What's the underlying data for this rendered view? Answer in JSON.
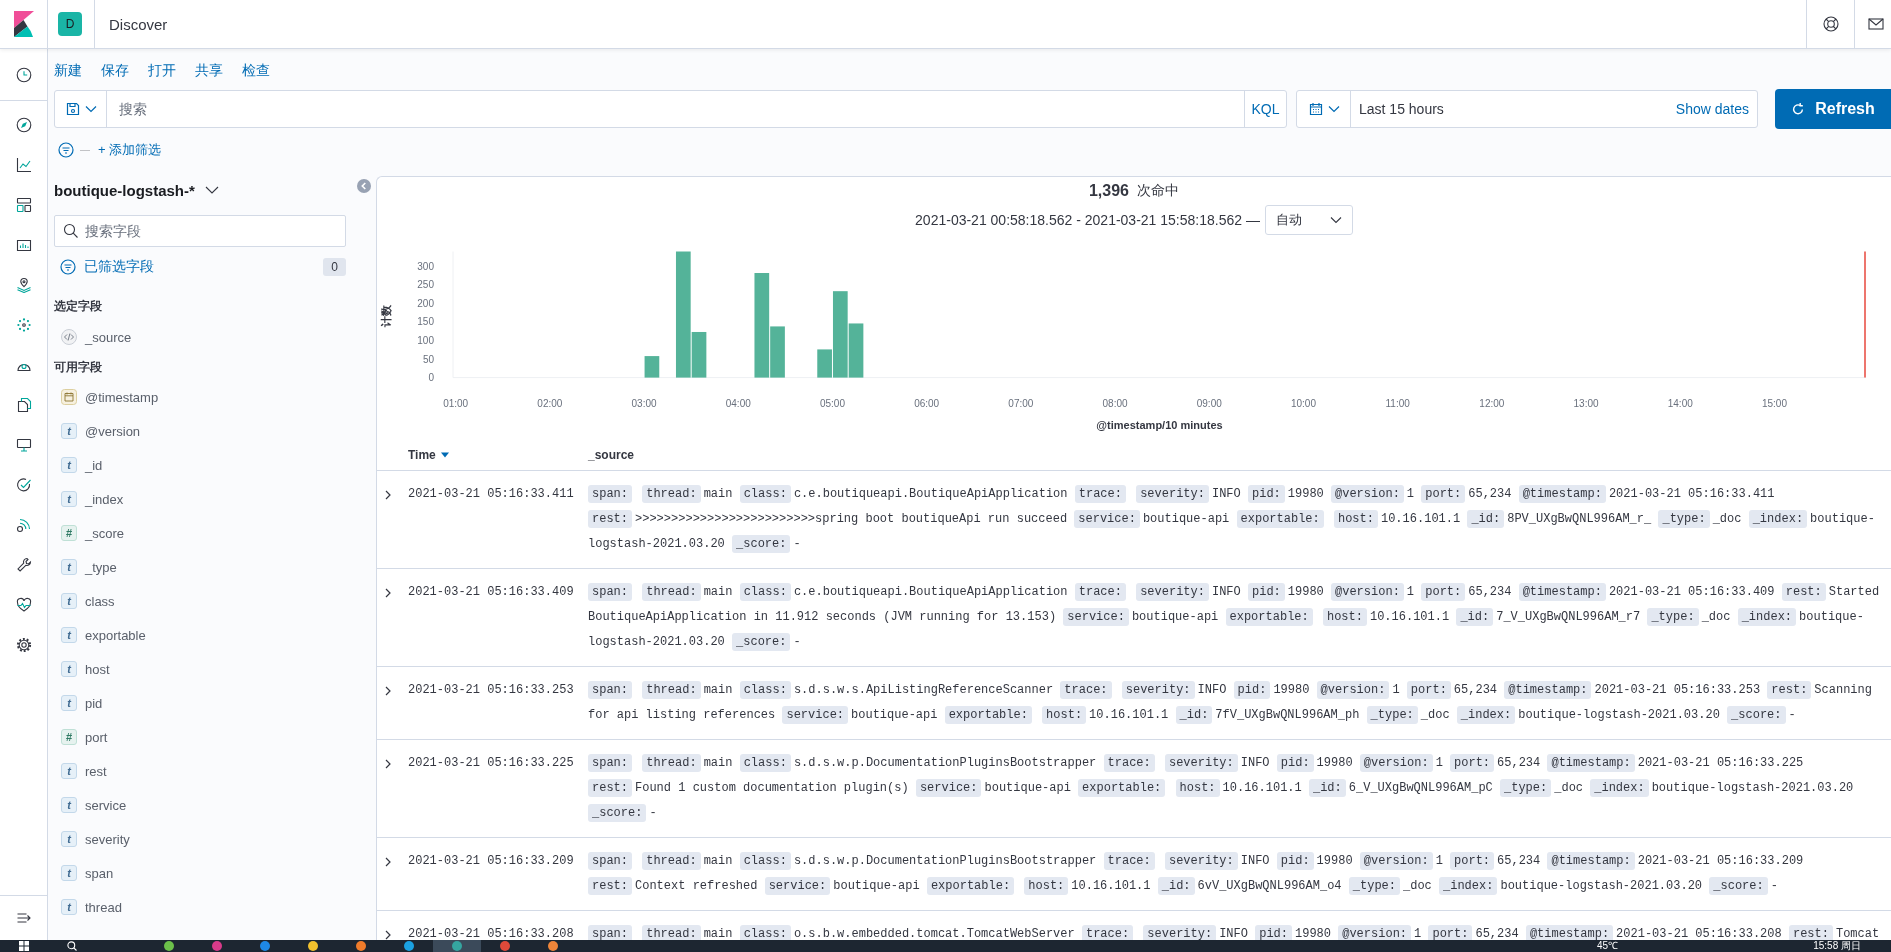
{
  "header": {
    "space": "D",
    "title": "Discover"
  },
  "top_menu": [
    "新建",
    "保存",
    "打开",
    "共享",
    "检查"
  ],
  "query_bar": {
    "placeholder": "搜索",
    "language": "KQL"
  },
  "date_picker": {
    "value": "Last 15 hours",
    "show_dates": "Show dates"
  },
  "refresh_button": "Refresh",
  "filter_bar": {
    "add_filter": "+ 添加筛选"
  },
  "sidebar": {
    "index_pattern": "boutique-logstash-*",
    "search_placeholder": "搜索字段",
    "filtered_fields": {
      "label": "已筛选字段",
      "count": "0"
    },
    "selected_heading": "选定字段",
    "selected_fields": [
      {
        "name": "_source",
        "kind": "source"
      }
    ],
    "available_heading": "可用字段",
    "available_fields": [
      {
        "name": "@timestamp",
        "kind": "date"
      },
      {
        "name": "@version",
        "kind": "string",
        "token": "t"
      },
      {
        "name": "_id",
        "kind": "string",
        "token": "t"
      },
      {
        "name": "_index",
        "kind": "string",
        "token": "t"
      },
      {
        "name": "_score",
        "kind": "number",
        "token": "#"
      },
      {
        "name": "_type",
        "kind": "string",
        "token": "t"
      },
      {
        "name": "class",
        "kind": "string",
        "token": "t"
      },
      {
        "name": "exportable",
        "kind": "string",
        "token": "t"
      },
      {
        "name": "host",
        "kind": "string",
        "token": "t"
      },
      {
        "name": "pid",
        "kind": "string",
        "token": "t"
      },
      {
        "name": "port",
        "kind": "number",
        "token": "#"
      },
      {
        "name": "rest",
        "kind": "string",
        "token": "t"
      },
      {
        "name": "service",
        "kind": "string",
        "token": "t"
      },
      {
        "name": "severity",
        "kind": "string",
        "token": "t"
      },
      {
        "name": "span",
        "kind": "string",
        "token": "t"
      },
      {
        "name": "thread",
        "kind": "string",
        "token": "t"
      }
    ]
  },
  "histogram": {
    "hits": "1,396",
    "hits_label": "次命中",
    "range": "2021-03-21 00:58:18.562 - 2021-03-21 15:58:18.562 —",
    "interval": "自动",
    "chart_data": {
      "type": "bar",
      "xlabel": "@timestamp/10 minutes",
      "ylabel": "计数",
      "x": [
        185,
        205,
        215,
        255,
        265,
        295,
        305,
        315
      ],
      "values": [
        58,
        340,
        123,
        282,
        138,
        76,
        233,
        146
      ],
      "xlim": [
        58.3,
        958.3
      ],
      "ylim": [
        0,
        340
      ],
      "xticks": [
        {
          "value": 60,
          "label": "01:00"
        },
        {
          "value": 120,
          "label": "02:00"
        },
        {
          "value": 180,
          "label": "03:00"
        },
        {
          "value": 240,
          "label": "04:00"
        },
        {
          "value": 300,
          "label": "05:00"
        },
        {
          "value": 360,
          "label": "06:00"
        },
        {
          "value": 420,
          "label": "07:00"
        },
        {
          "value": 480,
          "label": "08:00"
        },
        {
          "value": 540,
          "label": "09:00"
        },
        {
          "value": 600,
          "label": "10:00"
        },
        {
          "value": 660,
          "label": "11:00"
        },
        {
          "value": 720,
          "label": "12:00"
        },
        {
          "value": 780,
          "label": "13:00"
        },
        {
          "value": 840,
          "label": "14:00"
        },
        {
          "value": 900,
          "label": "15:00"
        }
      ],
      "yticks": [
        0,
        50,
        100,
        150,
        200,
        250,
        300
      ]
    }
  },
  "table": {
    "columns": [
      {
        "label": "Time",
        "sorted": true
      },
      {
        "label": "_source",
        "sorted": false
      }
    ],
    "rows": [
      {
        "time": "2021-03-21 05:16:33.411",
        "expanded": false,
        "fields": [
          {
            "key": "span:"
          },
          {
            "key": "thread:",
            "value": "main"
          },
          {
            "key": "class:",
            "value": "c.e.boutiqueapi.BoutiqueApiApplication"
          },
          {
            "key": "trace:"
          },
          {
            "key": "severity:",
            "value": "INFO"
          },
          {
            "key": "pid:",
            "value": "19980"
          },
          {
            "key": "@version:",
            "value": "1"
          },
          {
            "key": "port:",
            "value": "65,234"
          },
          {
            "key": "@timestamp:",
            "value": "2021-03-21 05:16:33.411"
          },
          {
            "key": "rest:",
            "value": ">>>>>>>>>>>>>>>>>>>>>>>>>spring boot boutiqueApi run succeed"
          },
          {
            "key": "service:",
            "value": "boutique-api"
          },
          {
            "key": "exportable:"
          },
          {
            "key": "host:",
            "value": "10.16.101.1"
          },
          {
            "key": "_id:",
            "value": "8PV_UXgBwQNL996AM_r_"
          },
          {
            "key": "_type:",
            "value": "_doc"
          },
          {
            "key": "_index:",
            "value": "boutique-logstash-2021.03.20"
          },
          {
            "key": "_score:",
            "value": "-"
          }
        ]
      },
      {
        "time": "2021-03-21 05:16:33.409",
        "expanded": false,
        "fields": [
          {
            "key": "span:"
          },
          {
            "key": "thread:",
            "value": "main"
          },
          {
            "key": "class:",
            "value": "c.e.boutiqueapi.BoutiqueApiApplication"
          },
          {
            "key": "trace:"
          },
          {
            "key": "severity:",
            "value": "INFO"
          },
          {
            "key": "pid:",
            "value": "19980"
          },
          {
            "key": "@version:",
            "value": "1"
          },
          {
            "key": "port:",
            "value": "65,234"
          },
          {
            "key": "@timestamp:",
            "value": "2021-03-21 05:16:33.409"
          },
          {
            "key": "rest:",
            "value": "Started BoutiqueApiApplication in 11.912 seconds (JVM running for 13.153)"
          },
          {
            "key": "service:",
            "value": "boutique-api"
          },
          {
            "key": "exportable:"
          },
          {
            "key": "host:",
            "value": "10.16.101.1"
          },
          {
            "key": "_id:",
            "value": "7_V_UXgBwQNL996AM_r7"
          },
          {
            "key": "_type:",
            "value": "_doc"
          },
          {
            "key": "_index:",
            "value": "boutique-logstash-2021.03.20"
          },
          {
            "key": "_score:",
            "value": "-"
          }
        ]
      },
      {
        "time": "2021-03-21 05:16:33.253",
        "expanded": false,
        "fields": [
          {
            "key": "span:"
          },
          {
            "key": "thread:",
            "value": "main"
          },
          {
            "key": "class:",
            "value": "s.d.s.w.s.ApiListingReferenceScanner"
          },
          {
            "key": "trace:"
          },
          {
            "key": "severity:",
            "value": "INFO"
          },
          {
            "key": "pid:",
            "value": "19980"
          },
          {
            "key": "@version:",
            "value": "1"
          },
          {
            "key": "port:",
            "value": "65,234"
          },
          {
            "key": "@timestamp:",
            "value": "2021-03-21 05:16:33.253"
          },
          {
            "key": "rest:",
            "value": "Scanning for api listing references"
          },
          {
            "key": "service:",
            "value": "boutique-api"
          },
          {
            "key": "exportable:"
          },
          {
            "key": "host:",
            "value": "10.16.101.1"
          },
          {
            "key": "_id:",
            "value": "7fV_UXgBwQNL996AM_ph"
          },
          {
            "key": "_type:",
            "value": "_doc"
          },
          {
            "key": "_index:",
            "value": "boutique-logstash-2021.03.20"
          },
          {
            "key": "_score:",
            "value": "-"
          }
        ]
      },
      {
        "time": "2021-03-21 05:16:33.225",
        "expanded": false,
        "fields": [
          {
            "key": "span:"
          },
          {
            "key": "thread:",
            "value": "main"
          },
          {
            "key": "class:",
            "value": "s.d.s.w.p.DocumentationPluginsBootstrapper"
          },
          {
            "key": "trace:"
          },
          {
            "key": "severity:",
            "value": "INFO"
          },
          {
            "key": "pid:",
            "value": "19980"
          },
          {
            "key": "@version:",
            "value": "1"
          },
          {
            "key": "port:",
            "value": "65,234"
          },
          {
            "key": "@timestamp:",
            "value": "2021-03-21 05:16:33.225"
          },
          {
            "key": "rest:",
            "value": "Found 1 custom documentation plugin(s)"
          },
          {
            "key": "service:",
            "value": "boutique-api"
          },
          {
            "key": "exportable:"
          },
          {
            "key": "host:",
            "value": "10.16.101.1"
          },
          {
            "key": "_id:",
            "value": "6_V_UXgBwQNL996AM_pC"
          },
          {
            "key": "_type:",
            "value": "_doc"
          },
          {
            "key": "_index:",
            "value": "boutique-logstash-2021.03.20"
          },
          {
            "key": "_score:",
            "value": "-"
          }
        ]
      },
      {
        "time": "2021-03-21 05:16:33.209",
        "expanded": false,
        "fields": [
          {
            "key": "span:"
          },
          {
            "key": "thread:",
            "value": "main"
          },
          {
            "key": "class:",
            "value": "s.d.s.w.p.DocumentationPluginsBootstrapper"
          },
          {
            "key": "trace:"
          },
          {
            "key": "severity:",
            "value": "INFO"
          },
          {
            "key": "pid:",
            "value": "19980"
          },
          {
            "key": "@version:",
            "value": "1"
          },
          {
            "key": "port:",
            "value": "65,234"
          },
          {
            "key": "@timestamp:",
            "value": "2021-03-21 05:16:33.209"
          },
          {
            "key": "rest:",
            "value": "Context refreshed"
          },
          {
            "key": "service:",
            "value": "boutique-api"
          },
          {
            "key": "exportable:"
          },
          {
            "key": "host:",
            "value": "10.16.101.1"
          },
          {
            "key": "_id:",
            "value": "6vV_UXgBwQNL996AM_o4"
          },
          {
            "key": "_type:",
            "value": "_doc"
          },
          {
            "key": "_index:",
            "value": "boutique-logstash-2021.03.20"
          },
          {
            "key": "_score:",
            "value": "-"
          }
        ]
      },
      {
        "time": "2021-03-21 05:16:33.208",
        "expanded": false,
        "fields": [
          {
            "key": "span:"
          },
          {
            "key": "thread:",
            "value": "main"
          },
          {
            "key": "class:",
            "value": "o.s.b.w.embedded.tomcat.TomcatWebServer"
          },
          {
            "key": "trace:"
          },
          {
            "key": "severity:",
            "value": "INFO"
          },
          {
            "key": "pid:",
            "value": "19980"
          },
          {
            "key": "@version:",
            "value": "1"
          },
          {
            "key": "port:",
            "value": "65,234"
          },
          {
            "key": "@timestamp:",
            "value": "2021-03-21 05:16:33.208"
          },
          {
            "key": "rest:",
            "value": "Tomcat"
          }
        ]
      }
    ]
  },
  "taskbar": {
    "apps": [
      {
        "color": "#6cc04a",
        "selected": false
      },
      {
        "color": "#d83b8a",
        "selected": false
      },
      {
        "color": "#1e88e5",
        "selected": false
      },
      {
        "color": "#f2c12e",
        "selected": false
      },
      {
        "color": "#f07c2b",
        "selected": false
      },
      {
        "color": "#1ba1e2",
        "selected": false
      },
      {
        "color": "#35a5a0",
        "selected": true
      },
      {
        "color": "#e04a3a",
        "selected": false
      },
      {
        "color": "#f0863a",
        "selected": false
      }
    ],
    "temperature": "45℃",
    "clock": "15:58 周日"
  }
}
